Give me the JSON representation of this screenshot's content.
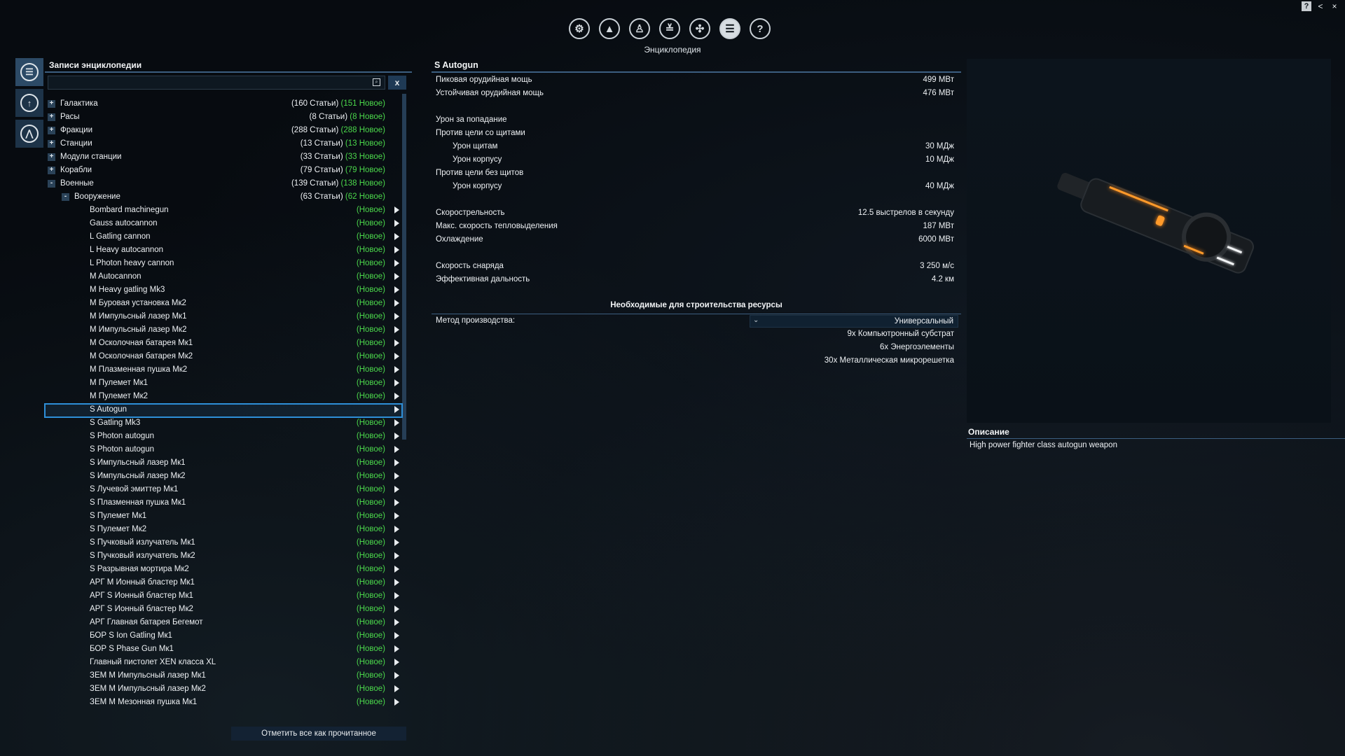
{
  "top_nav": {
    "caption": "Энциклопедия",
    "icons": [
      "settings-icon",
      "ship-icon",
      "person-icon",
      "rank-icon",
      "map-icon",
      "encyclopedia-icon",
      "help-icon"
    ]
  },
  "window": {
    "help": "?",
    "back": "<",
    "close": "×"
  },
  "left_panel": {
    "title": "Записи энциклопедии",
    "search": {
      "value": "",
      "placeholder": ""
    },
    "clear_label": "x",
    "categories": [
      {
        "label": "Галактика",
        "count": "(160 Статьи)",
        "new": "(151 Новое)",
        "expander": "+"
      },
      {
        "label": "Расы",
        "count": "(8 Статьи)",
        "new": "(8 Новое)",
        "expander": "+"
      },
      {
        "label": "Фракции",
        "count": "(288 Статьи)",
        "new": "(288 Новое)",
        "expander": "+"
      },
      {
        "label": "Станции",
        "count": "(13 Статьи)",
        "new": "(13 Новое)",
        "expander": "+"
      },
      {
        "label": "Модули станции",
        "count": "(33 Статьи)",
        "new": "(33 Новое)",
        "expander": "+"
      },
      {
        "label": "Корабли",
        "count": "(79 Статьи)",
        "new": "(79 Новое)",
        "expander": "+"
      },
      {
        "label": "Военные",
        "count": "(139 Статьи)",
        "new": "(138 Новое)",
        "expander": "-"
      }
    ],
    "subcategory": {
      "label": "Вооружение",
      "count": "(63 Статьи)",
      "new": "(62 Новое)",
      "expander": "-"
    },
    "new_tag": "(Новое)",
    "items": [
      {
        "label": "Bombard machinegun",
        "is_new": true
      },
      {
        "label": "Gauss autocannon",
        "is_new": true
      },
      {
        "label": "L Gatling cannon",
        "is_new": true
      },
      {
        "label": "L Heavy autocannon",
        "is_new": true
      },
      {
        "label": "L Photon heavy cannon",
        "is_new": true
      },
      {
        "label": "M Autocannon",
        "is_new": true
      },
      {
        "label": "M Heavy gatling Mk3",
        "is_new": true
      },
      {
        "label": "M Буровая установка Мк2",
        "is_new": true
      },
      {
        "label": "M Импульсный лазер Мк1",
        "is_new": true
      },
      {
        "label": "M Импульсный лазер Мк2",
        "is_new": true
      },
      {
        "label": "M Осколочная батарея Мк1",
        "is_new": true
      },
      {
        "label": "M Осколочная батарея Мк2",
        "is_new": true
      },
      {
        "label": "M Плазменная пушка Мк2",
        "is_new": true
      },
      {
        "label": "M Пулемет Мк1",
        "is_new": true
      },
      {
        "label": "M Пулемет Мк2",
        "is_new": true
      },
      {
        "label": "S Autogun",
        "is_new": false,
        "selected": true
      },
      {
        "label": "S Gatling Mk3",
        "is_new": true
      },
      {
        "label": "S Photon autogun",
        "is_new": true
      },
      {
        "label": "S Photon autogun",
        "is_new": true
      },
      {
        "label": "S Импульсный лазер Мк1",
        "is_new": true
      },
      {
        "label": "S Импульсный лазер Мк2",
        "is_new": true
      },
      {
        "label": "S Лучевой эмиттер Мк1",
        "is_new": true
      },
      {
        "label": "S Плазменная пушка Мк1",
        "is_new": true
      },
      {
        "label": "S Пулемет Мк1",
        "is_new": true
      },
      {
        "label": "S Пулемет Мк2",
        "is_new": true
      },
      {
        "label": "S Пучковый излучатель Мк1",
        "is_new": true
      },
      {
        "label": "S Пучковый излучатель Мк2",
        "is_new": true
      },
      {
        "label": "S Разрывная мортира Мк2",
        "is_new": true
      },
      {
        "label": "АРГ M Ионный бластер Мк1",
        "is_new": true
      },
      {
        "label": "АРГ S Ионный бластер Мк1",
        "is_new": true
      },
      {
        "label": "АРГ S Ионный бластер Мк2",
        "is_new": true
      },
      {
        "label": "АРГ Главная батарея Бегемот",
        "is_new": true
      },
      {
        "label": "БОР S Ion Gatling Мк1",
        "is_new": true
      },
      {
        "label": "БОР S Phase Gun Мк1",
        "is_new": true
      },
      {
        "label": "Главный пистолет XEN класса XL",
        "is_new": true
      },
      {
        "label": "ЗЕМ M Импульсный лазер Мк1",
        "is_new": true
      },
      {
        "label": "ЗЕМ M Импульсный лазер Мк2",
        "is_new": true
      },
      {
        "label": "ЗЕМ M Мезонная пушка Мк1",
        "is_new": true
      }
    ],
    "mark_all_read": "Отметить все как прочитанное"
  },
  "details": {
    "title": "S Autogun",
    "stats": [
      {
        "key": "Пиковая орудийная мощь",
        "value": "499 МВт",
        "indent": false
      },
      {
        "key": "Устойчивая орудийная мощь",
        "value": "476 МВт",
        "indent": false
      },
      {
        "key": "",
        "value": "",
        "indent": false
      },
      {
        "key": "Урон за попадание",
        "value": "",
        "indent": false
      },
      {
        "key": "Против цели со щитами",
        "value": "",
        "indent": false
      },
      {
        "key": "Урон щитам",
        "value": "30 МДж",
        "indent": true
      },
      {
        "key": "Урон корпусу",
        "value": "10 МДж",
        "indent": true
      },
      {
        "key": "Против цели без щитов",
        "value": "",
        "indent": false
      },
      {
        "key": "Урон корпусу",
        "value": "40 МДж",
        "indent": true
      },
      {
        "key": "",
        "value": "",
        "indent": false
      },
      {
        "key": "Скорострельность",
        "value": "12.5 выстрелов в секунду",
        "indent": false
      },
      {
        "key": "Макс. скорость тепловыделения",
        "value": "187 МВт",
        "indent": false
      },
      {
        "key": "Охлаждение",
        "value": "6000 МВт",
        "indent": false
      },
      {
        "key": "",
        "value": "",
        "indent": false
      },
      {
        "key": "Скорость снаряда",
        "value": "3 250 м/с",
        "indent": false
      },
      {
        "key": "Эффективная дальность",
        "value": "4.2 км",
        "indent": false
      }
    ],
    "resources_header": "Необходимые для строительства ресурсы",
    "method_label": "Метод производства:",
    "method_value": "Универсальный",
    "resources": [
      "9x Компьютронный субстрат",
      "6x Энергоэлементы",
      "30x Металлическая микрорешетка"
    ]
  },
  "description": {
    "title": "Описание",
    "text": "High power fighter class autogun weapon"
  },
  "colors": {
    "accent": "#2e8fd8",
    "new": "#4bd84b",
    "panel_line": "#3c5e80"
  }
}
